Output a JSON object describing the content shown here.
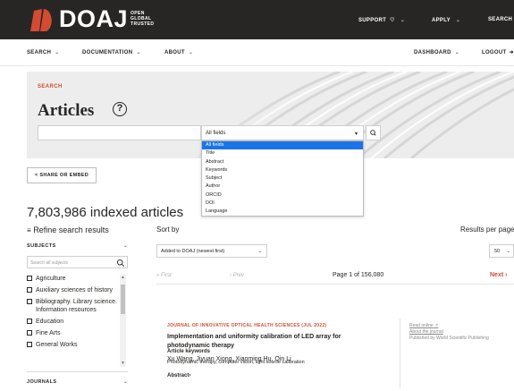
{
  "brand": {
    "name": "DOAJ",
    "tagline": [
      "OPEN",
      "GLOBAL",
      "TRUSTED"
    ],
    "accent_color": "#d34b32",
    "bar_color": "#282624"
  },
  "top_nav": [
    {
      "label": "SUPPORT",
      "icon": "heart-icon"
    },
    {
      "label": "APPLY"
    },
    {
      "label": "SEARCH"
    }
  ],
  "sub_nav": {
    "left": [
      "SEARCH",
      "DOCUMENTATION",
      "ABOUT"
    ],
    "right": [
      "DASHBOARD",
      "LOGOUT"
    ]
  },
  "hero": {
    "label": "SEARCH",
    "title": "Articles",
    "help_icon": "question-circle-icon"
  },
  "search": {
    "query": "",
    "field_selected": "All fields",
    "field_options": [
      "All fields",
      "Title",
      "Abstract",
      "Keywords",
      "Subject",
      "Author",
      "ORCID",
      "DOI",
      "Language"
    ],
    "button_icon": "search-icon"
  },
  "share_label": "< SHARE OR EMBED",
  "results": {
    "count_text": "7,803,986 indexed articles",
    "refine_label": "Refine search results",
    "sort_label": "Sort by",
    "sort_value": "Added to DOAJ (newest first)",
    "rpp_label": "Results per page",
    "rpp_value": "50"
  },
  "filters": {
    "subjects_head": "SUBJECTS",
    "subjects_placeholder": "Search all subjects",
    "subjects": [
      "Agriculture",
      "Auxiliary sciences of history",
      "Bibliography. Library science. Information resources",
      "Education",
      "Fine Arts",
      "General Works"
    ],
    "journals_head": "JOURNALS"
  },
  "pagination": {
    "first": "« First",
    "prev": "‹ Prev",
    "info": "Page 1 of 156,080",
    "next": "Next ›"
  },
  "article": {
    "journal": "JOURNAL OF INNOVATIVE OPTICAL HEALTH SCIENCES (JUL 2022)",
    "title": "Implementation and uniformity calibration of LED array for photodynamic therapy",
    "authors": "Xu Wang, Jiyuan Xiong, Xiaoming Hu, Qin Li",
    "keywords_head": "Article keywords",
    "keywords": "Photodynamic therapy, computer vision, light source calibration",
    "abstract_toggle": "Abstract›",
    "read_online": "Read online",
    "about_journal": "About the journal",
    "publisher": "Published by World Scientific Publishing"
  }
}
